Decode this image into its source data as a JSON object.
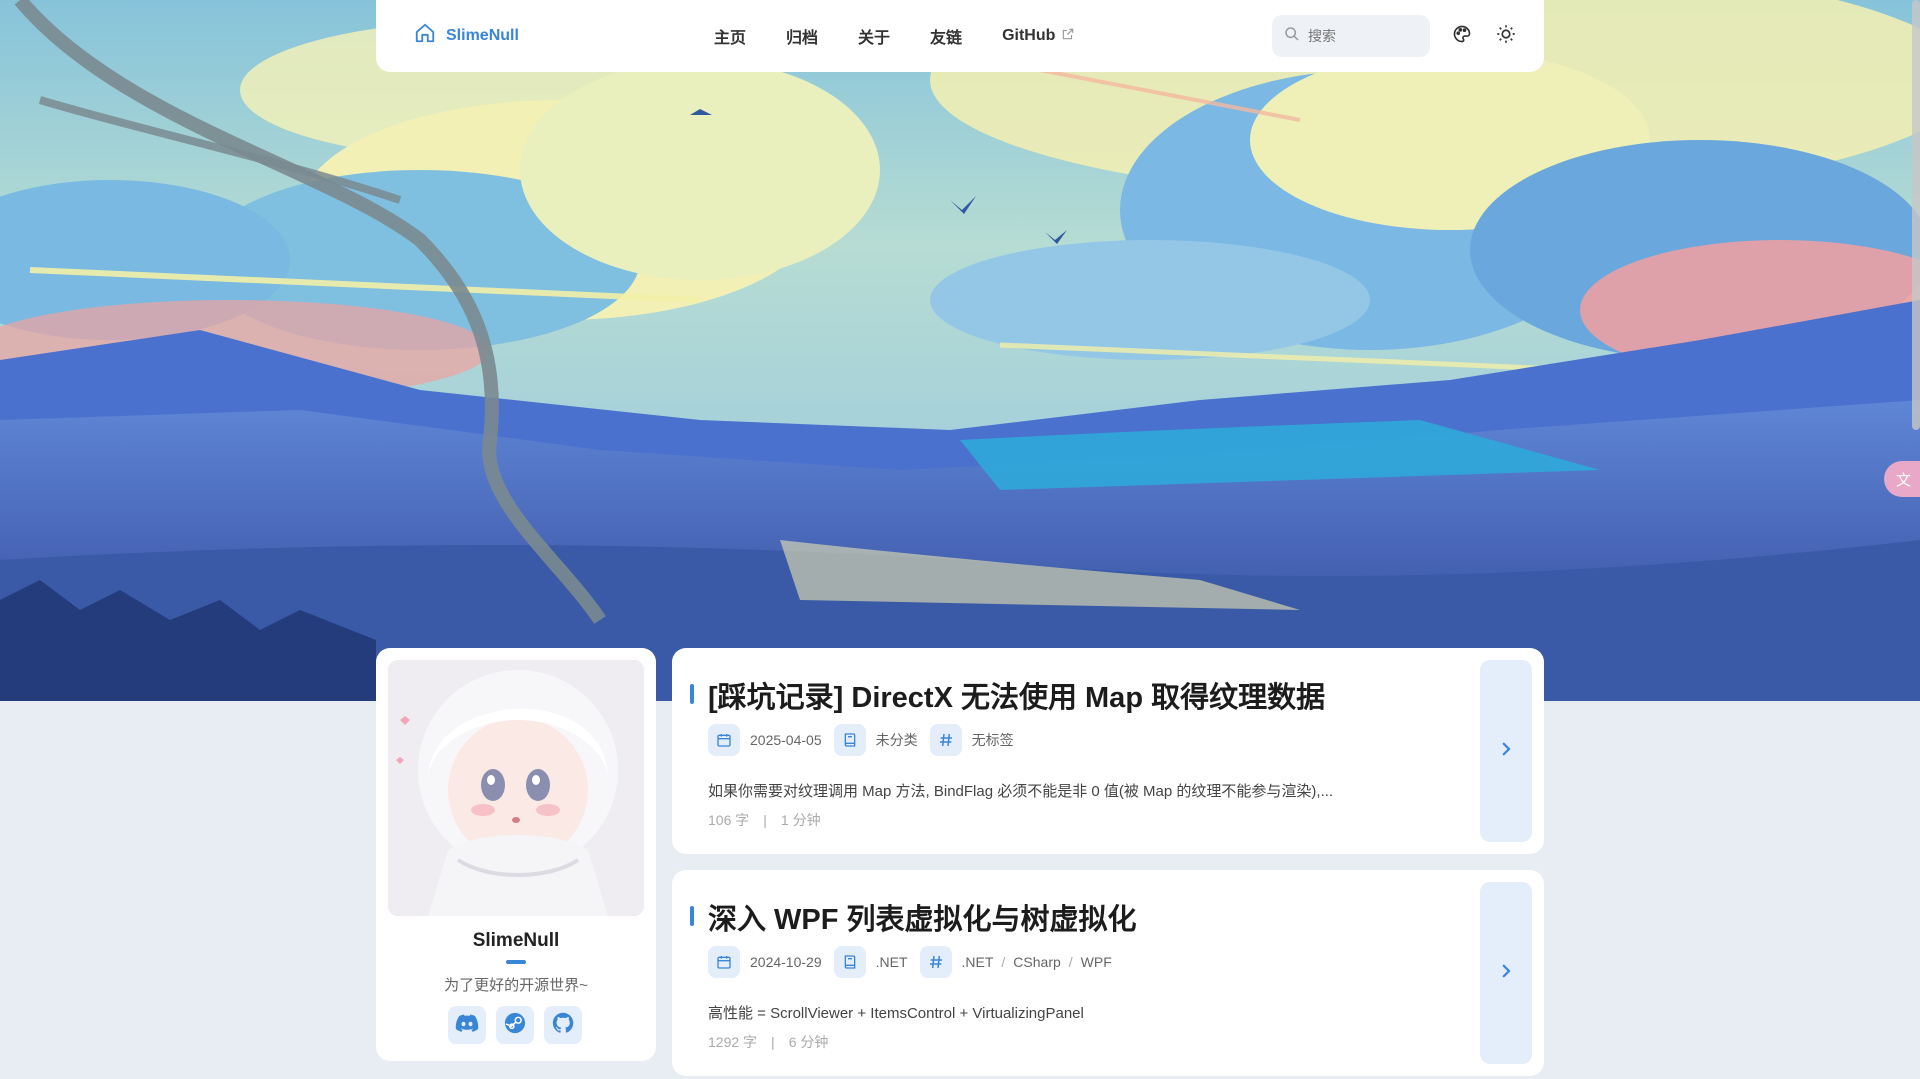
{
  "nav": {
    "brand": "SlimeNull",
    "menu": [
      "主页",
      "归档",
      "关于",
      "友链",
      "GitHub"
    ],
    "search_placeholder": "搜索"
  },
  "profile": {
    "name": "SlimeNull",
    "bio": "为了更好的开源世界~",
    "socials": [
      "discord-icon",
      "steam-icon",
      "github-icon"
    ]
  },
  "posts": [
    {
      "title": "[踩坑记录] DirectX 无法使用 Map 取得纹理数据",
      "date": "2025-04-05",
      "category": "未分类",
      "tags": [
        "无标签"
      ],
      "excerpt": "如果你需要对纹理调用 Map 方法, BindFlag 必须不能是非 0 值(被 Map 的纹理不能参与渲染),...",
      "words": "106 字",
      "time": "1 分钟"
    },
    {
      "title": "深入 WPF 列表虚拟化与树虚拟化",
      "date": "2024-10-29",
      "category": ".NET",
      "tags": [
        ".NET",
        "CSharp",
        "WPF"
      ],
      "excerpt": "高性能 = ScrollViewer + ItemsControl + VirtualizingPanel",
      "words": "1292 字",
      "time": "6 分钟"
    }
  ],
  "translate_label": "文",
  "colors": {
    "accent": "#3a86d6",
    "page_bg": "#e8edf4",
    "chip_bg": "#e4edfa"
  }
}
